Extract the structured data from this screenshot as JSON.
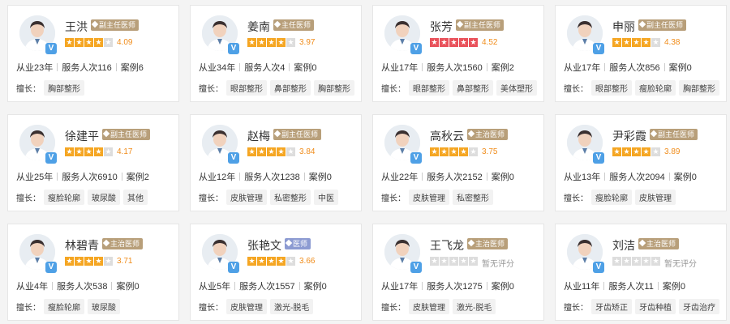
{
  "doctors": [
    {
      "name": "王洪",
      "title": "副主任医师",
      "title_color": "#b89f7a",
      "rating": "4.09",
      "stars": 4,
      "star_color": "orange",
      "years": "从业23年",
      "services": "服务人次116",
      "cases": "案例6",
      "specialty_label": "擅长：",
      "tags": [
        "胸部整形"
      ]
    },
    {
      "name": "姜南",
      "title": "主任医师",
      "title_color": "#b89f7a",
      "rating": "3.97",
      "stars": 4,
      "star_color": "orange",
      "years": "从业34年",
      "services": "服务人次4",
      "cases": "案例0",
      "specialty_label": "擅长：",
      "tags": [
        "眼部整形",
        "鼻部整形",
        "胸部整形"
      ]
    },
    {
      "name": "张芳",
      "title": "副主任医师",
      "title_color": "#b89f7a",
      "rating": "4.52",
      "stars": 5,
      "star_color": "red",
      "years": "从业17年",
      "services": "服务人次1560",
      "cases": "案例2",
      "specialty_label": "擅长：",
      "tags": [
        "眼部整形",
        "鼻部整形",
        "美体塑形"
      ]
    },
    {
      "name": "申丽",
      "title": "副主任医师",
      "title_color": "#b89f7a",
      "rating": "4.38",
      "stars": 4,
      "star_color": "orange",
      "years": "从业17年",
      "services": "服务人次856",
      "cases": "案例0",
      "specialty_label": "擅长：",
      "tags": [
        "眼部整形",
        "瘦脸轮廓",
        "胸部整形"
      ]
    },
    {
      "name": "徐建平",
      "title": "副主任医师",
      "title_color": "#b89f7a",
      "rating": "4.17",
      "stars": 4,
      "star_color": "orange",
      "years": "从业25年",
      "services": "服务人次6910",
      "cases": "案例2",
      "specialty_label": "擅长：",
      "tags": [
        "瘦脸轮廓",
        "玻尿酸",
        "其他"
      ]
    },
    {
      "name": "赵梅",
      "title": "副主任医师",
      "title_color": "#b89f7a",
      "rating": "3.84",
      "stars": 4,
      "star_color": "orange",
      "years": "从业12年",
      "services": "服务人次1238",
      "cases": "案例0",
      "specialty_label": "擅长：",
      "tags": [
        "皮肤管理",
        "私密整形",
        "中医"
      ]
    },
    {
      "name": "高秋云",
      "title": "主治医师",
      "title_color": "#b89f7a",
      "rating": "3.75",
      "stars": 4,
      "star_color": "orange",
      "years": "从业22年",
      "services": "服务人次2152",
      "cases": "案例0",
      "specialty_label": "擅长：",
      "tags": [
        "皮肤管理",
        "私密整形"
      ]
    },
    {
      "name": "尹彩霞",
      "title": "副主任医师",
      "title_color": "#b89f7a",
      "rating": "3.89",
      "stars": 4,
      "star_color": "orange",
      "years": "从业13年",
      "services": "服务人次2094",
      "cases": "案例0",
      "specialty_label": "擅长：",
      "tags": [
        "瘦脸轮廓",
        "皮肤管理"
      ]
    },
    {
      "name": "林碧青",
      "title": "主治医师",
      "title_color": "#b89f7a",
      "rating": "3.71",
      "stars": 4,
      "star_color": "orange",
      "years": "从业4年",
      "services": "服务人次538",
      "cases": "案例0",
      "specialty_label": "擅长：",
      "tags": [
        "瘦脸轮廓",
        "玻尿酸"
      ]
    },
    {
      "name": "张艳文",
      "title": "医师",
      "title_color": "#8c9bd2",
      "rating": "3.66",
      "stars": 4,
      "star_color": "orange",
      "years": "从业5年",
      "services": "服务人次1557",
      "cases": "案例0",
      "specialty_label": "擅长：",
      "tags": [
        "皮肤管理",
        "激光-脱毛"
      ]
    },
    {
      "name": "王飞龙",
      "title": "主治医师",
      "title_color": "#b89f7a",
      "rating": "暂无评分",
      "stars": 0,
      "star_color": "orange",
      "years": "从业17年",
      "services": "服务人次1275",
      "cases": "案例0",
      "specialty_label": "擅长：",
      "tags": [
        "皮肤管理",
        "激光-脱毛"
      ]
    },
    {
      "name": "刘洁",
      "title": "主治医师",
      "title_color": "#b89f7a",
      "rating": "暂无评分",
      "stars": 0,
      "star_color": "orange",
      "years": "从业11年",
      "services": "服务人次11",
      "cases": "案例0",
      "specialty_label": "擅长：",
      "tags": [
        "牙齿矫正",
        "牙齿种植",
        "牙齿治疗"
      ]
    }
  ]
}
